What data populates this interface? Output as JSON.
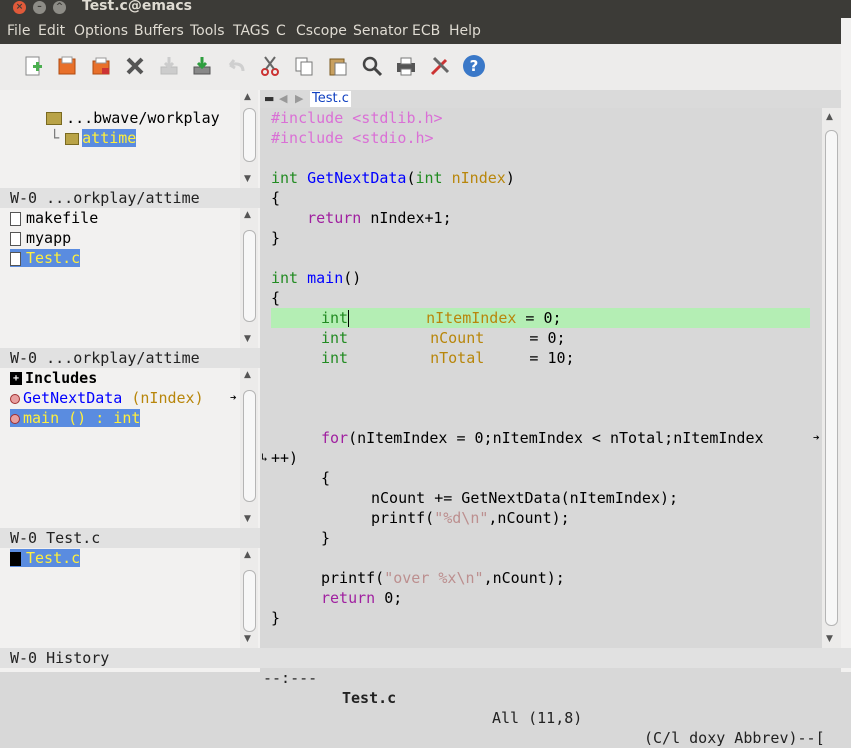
{
  "window": {
    "title": "Test.c@emacs"
  },
  "menu": [
    "File",
    "Edit",
    "Options",
    "Buffers",
    "Tools",
    "TAGS",
    "C",
    "Cscope",
    "Senator",
    "ECB",
    "Help"
  ],
  "toolbar": [
    "new-file-icon",
    "open-file-icon",
    "open-dir-icon",
    "close-icon",
    "save-icon",
    "save-as-icon",
    "undo-icon",
    "cut-icon",
    "copy-icon",
    "paste-icon",
    "search-icon",
    "print-icon",
    "preferences-icon",
    "help-icon"
  ],
  "dir_pane": {
    "root": "...bwave/workplay",
    "child": "attime",
    "modeline": "W-0 ...orkplay/attime"
  },
  "source_pane": {
    "files": [
      "makefile",
      "myapp",
      "Test.c"
    ],
    "modeline": "W-0 ...orkplay/attime"
  },
  "methods_pane": {
    "includes": "Includes",
    "item1_name": "GetNextData",
    "item1_args": "(nIndex)",
    "item2": "main () : int",
    "modeline": "W-0 Test.c"
  },
  "history_pane": {
    "item": "Test.c",
    "modeline": "W-0 History"
  },
  "editor": {
    "tab": "Test.c",
    "lines": {
      "l1": "#include <stdlib.h>",
      "l2": "#include <stdio.h>",
      "l4a": "int",
      "l4b": "GetNextData",
      "l4c": "(",
      "l4d": "int",
      "l4e": "nIndex",
      "l4f": ")",
      "l5": "{",
      "l6a": "    return",
      "l6b": " nIndex+1;",
      "l7": "}",
      "l9a": "int",
      "l9b": "main",
      "l9c": "()",
      "l10": "{",
      "l11a": "int",
      "l11b": "nItemIndex",
      "l11c": " = 0;",
      "l12a": "int",
      "l12b": "nCount",
      "l12c": "     = 0;",
      "l13a": "int",
      "l13b": "nTotal",
      "l13c": "     = 10;",
      "l17a": "for",
      "l17b": "(nItemIndex = 0;nItemIndex < nTotal;nItemIndex",
      "l18": "++)",
      "l19": "{",
      "l20": "nCount += GetNextData(nItemIndex);",
      "l21a": "printf(",
      "l21b": "\"%d\\n\"",
      "l21c": ",nCount);",
      "l22": "}",
      "l24a": "printf(",
      "l24b": "\"over %x\\n\"",
      "l24c": ",nCount);",
      "l25a": "return",
      "l25b": " 0;",
      "l26": "}"
    },
    "modeline": {
      "status": "--:---",
      "buffer": "Test.c",
      "position": "All (11,8)",
      "modes": "(C/l doxy Abbrev)--["
    }
  },
  "colors": {
    "highlight_line": "#b4eeb4",
    "selection": "#5a8ce0",
    "selection_text": "#ffef3c"
  }
}
